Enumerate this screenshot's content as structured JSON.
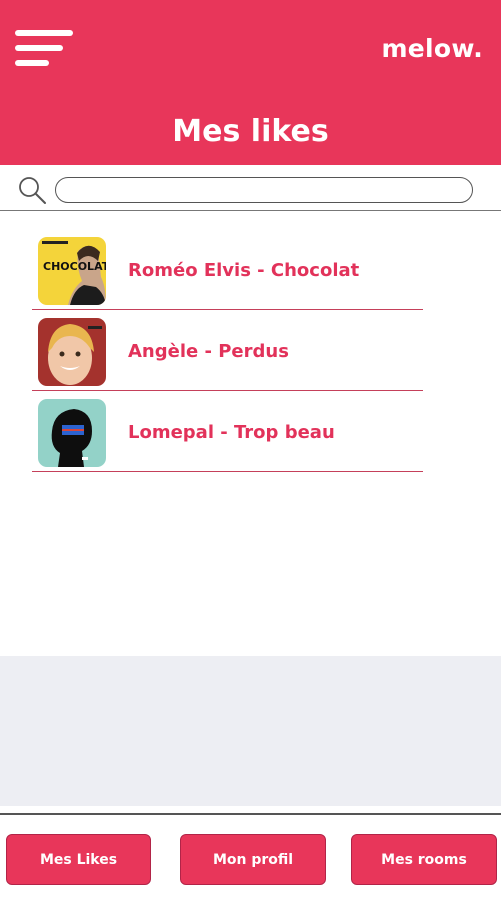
{
  "header": {
    "brand": "melow.",
    "title": "Mes likes",
    "menu_icon": "hamburger-menu-icon",
    "background_color": "#e8365a"
  },
  "search": {
    "icon": "search-icon",
    "value": "",
    "placeholder": ""
  },
  "likes": [
    {
      "title": "Roméo Elvis - Chocolat",
      "cover_icon": "album-cover-chocolat",
      "cover_text": "CHOCOLAT"
    },
    {
      "title": "Angèle - Perdus",
      "cover_icon": "album-cover-perdus"
    },
    {
      "title": "Lomepal - Trop beau",
      "cover_icon": "album-cover-trop-beau"
    }
  ],
  "bottom_nav": {
    "likes_label": "Mes Likes",
    "profile_label": "Mon profil",
    "rooms_label": "Mes rooms"
  },
  "colors": {
    "accent": "#e8365a",
    "text_accent": "#e2325a",
    "placeholder_area": "#edeef3"
  }
}
